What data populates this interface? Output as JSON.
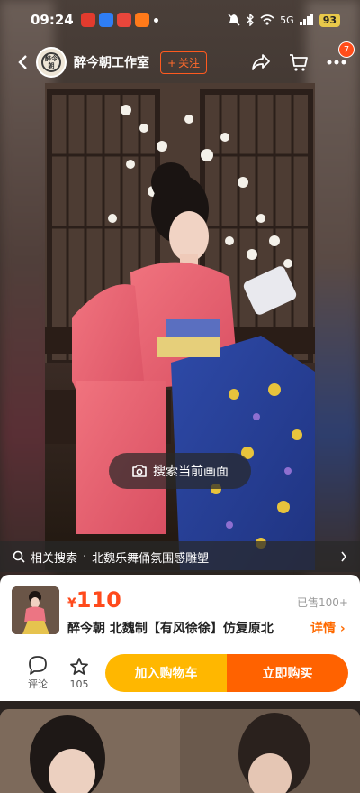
{
  "status_bar": {
    "time": "09:24",
    "network": "5G",
    "battery": "93",
    "colors": {
      "battery": "#e8c84a"
    }
  },
  "header": {
    "shop_name": "醉今朝工作室",
    "shop_avatar_text": "醉今朝",
    "follow_label": "关注",
    "cart_badge": "7"
  },
  "media": {
    "visual_search_label": "搜索当前画面",
    "related_search": {
      "label": "相关搜索",
      "separator": "·",
      "query": "北魏乐舞俑氛围感雕塑"
    }
  },
  "product": {
    "currency": "¥",
    "price": "110",
    "sold": "已售100+",
    "title": "醉今朝 北魏制【有风徐徐】仿复原北",
    "detail_label": "详情",
    "colors": {
      "price": "#ff4a1c",
      "accent": "#ff6a00"
    }
  },
  "actions": {
    "comment_label": "评论",
    "favorite_count": "105",
    "add_to_cart": "加入购物车",
    "buy_now": "立即购买",
    "colors": {
      "add_to_cart": "#ffb700",
      "buy_now": "#ff6200"
    }
  }
}
